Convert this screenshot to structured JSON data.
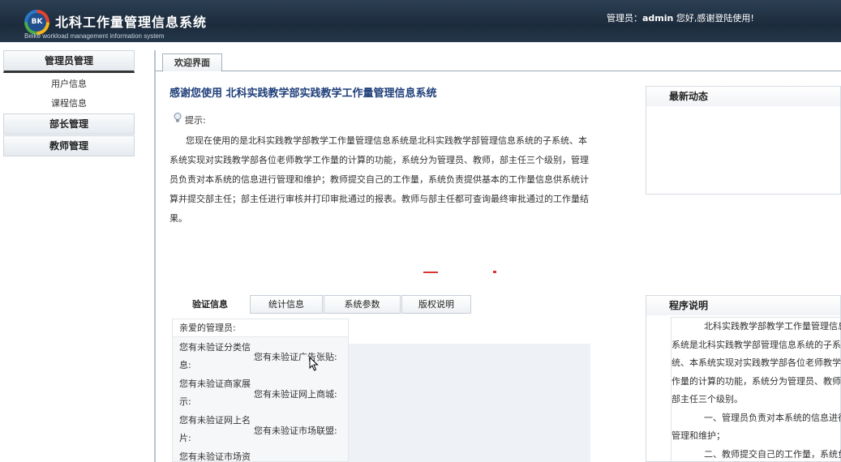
{
  "header": {
    "logo_text": "BK",
    "title": "北科工作量管理信息系统",
    "subtitle": "Beike workload management information system",
    "user_prefix": "管理员：",
    "user_name": "admin",
    "user_suffix": " 您好,感谢登陆使用!"
  },
  "sidebar": {
    "groups": [
      {
        "label": "管理员管理",
        "items": [
          "用户信息",
          "课程信息"
        ]
      },
      {
        "label": "部长管理"
      },
      {
        "label": "教师管理"
      }
    ]
  },
  "main": {
    "tab": "欢迎界面",
    "welcome_title": "感谢您使用 北科实践教学部实践教学工作量管理信息系统",
    "tip_label": "提示:",
    "tip_text": "您现在使用的是北科实践教学部教学工作量管理信息系统是北科实践教学部管理信息系统的子系统、本系统实现对实践教学部各位老师教学工作量的计算的功能，系统分为管理员、教师，部主任三个级别，管理员负责对本系统的信息进行管理和维护；教师提交自己的工作量，系统负责提供基本的工作量信息供系统计算并提交部主任；部主任进行审核并打印审批通过的报表。教师与部主任都可查询最终审批通过的工作量结果。",
    "news_title": "最新动态"
  },
  "subtabs": [
    "验证信息",
    "统计信息",
    "系统参数",
    "版权说明"
  ],
  "verify": {
    "greeting": "亲爱的管理员:",
    "left": [
      "您有未验证分类信息:",
      "您有未验证商家展示:",
      "您有未验证网上名片:",
      "您有未验证市场资"
    ],
    "right": [
      "您有未验证广告张贴:",
      "您有未验证网上商城:",
      "您有未验证市场联盟:"
    ]
  },
  "program": {
    "title": "程序说明",
    "lines": [
      {
        "text": "北科实践教学部教学工作量管理信息",
        "indent": true
      },
      {
        "text": "系统是北科实践教学部管理信息系统的子系",
        "indent": false
      },
      {
        "text": "统、本系统实现对实践教学部各位老师教学工",
        "indent": false
      },
      {
        "text": "作量的计算的功能，系统分为管理员、教师、",
        "indent": false
      },
      {
        "text": "部主任三个级别。",
        "indent": false
      },
      {
        "text": "一、管理员负责对本系统的信息进行",
        "indent": true
      },
      {
        "text": "管理和维护；",
        "indent": false
      },
      {
        "text": "二、教师提交自己的工作量，系统负",
        "indent": true
      }
    ]
  }
}
